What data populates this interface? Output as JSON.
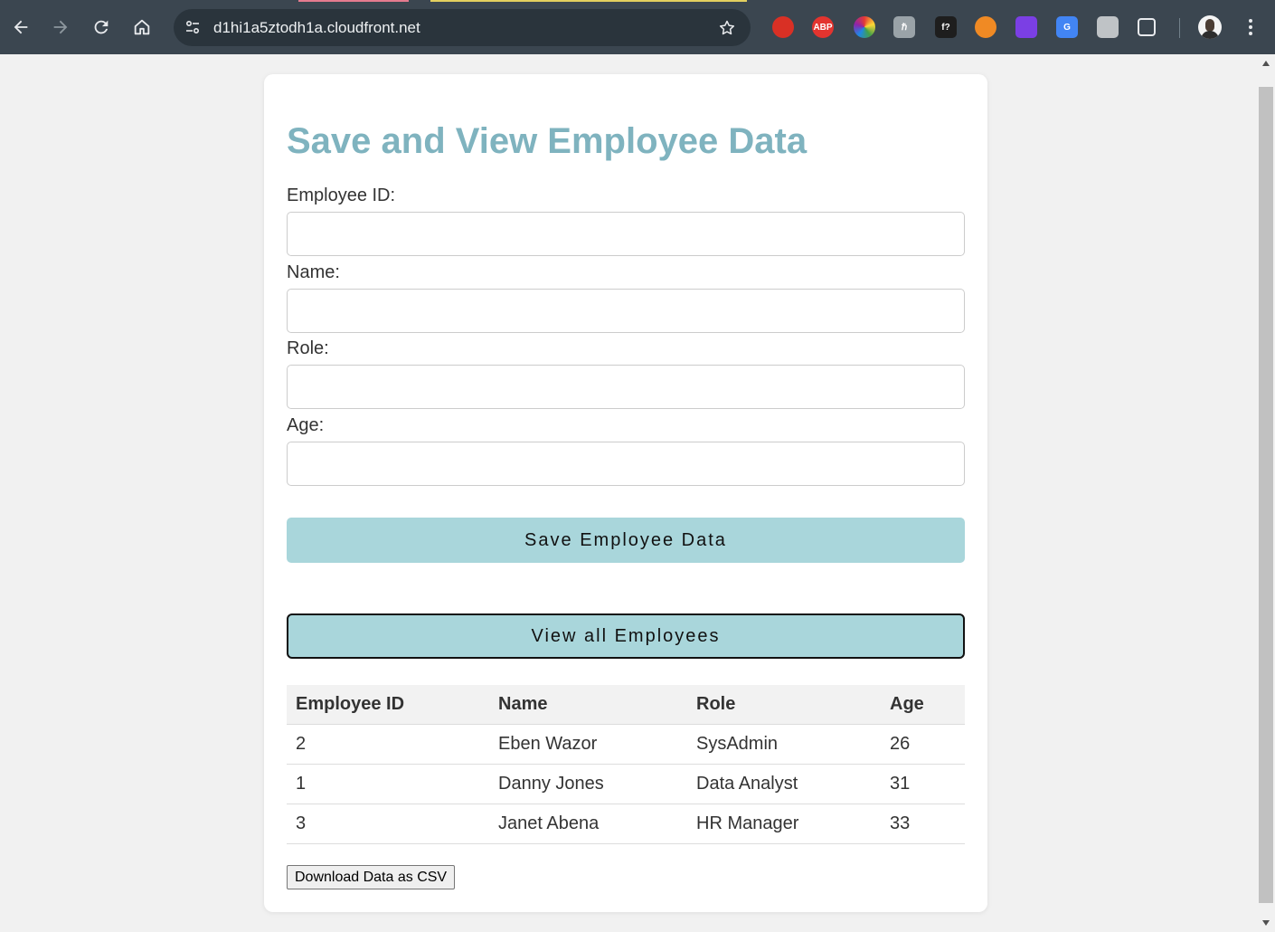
{
  "browser": {
    "url": "d1hi1a5ztodh1a.cloudfront.net",
    "extensions": [
      {
        "name": "stop-hand-extension-icon",
        "text": "",
        "color": "#d93025"
      },
      {
        "name": "adblock-plus-extension-icon",
        "text": "ABP",
        "color": "#e3342f"
      },
      {
        "name": "color-wheel-extension-icon",
        "text": "",
        "color": "#3ea34a"
      },
      {
        "name": "h-extension-icon",
        "text": "ℏ",
        "color": "#9aa3a8"
      },
      {
        "name": "font-finder-extension-icon",
        "text": "f?",
        "color": "#1e1e1e"
      },
      {
        "name": "firefox-relay-extension-icon",
        "text": "",
        "color": "#f08a24"
      },
      {
        "name": "purple-extension-icon",
        "text": "",
        "color": "#7b3fe4"
      },
      {
        "name": "google-translate-extension-icon",
        "text": "G",
        "color": "#4285f4"
      },
      {
        "name": "camera-extension-icon",
        "text": "",
        "color": "#bfc3c6"
      },
      {
        "name": "extensions-puzzle-icon",
        "text": "",
        "color": "#e8eaed"
      }
    ]
  },
  "page": {
    "title": "Save and View Employee Data",
    "form": {
      "employee_id_label": "Employee ID:",
      "employee_id_value": "",
      "name_label": "Name:",
      "name_value": "",
      "role_label": "Role:",
      "role_value": "",
      "age_label": "Age:",
      "age_value": ""
    },
    "save_button": "Save Employee Data",
    "view_button": "View all Employees",
    "table": {
      "headers": [
        "Employee ID",
        "Name",
        "Role",
        "Age"
      ],
      "rows": [
        [
          "2",
          "Eben Wazor",
          "SysAdmin",
          "26"
        ],
        [
          "1",
          "Danny Jones",
          "Data Analyst",
          "31"
        ],
        [
          "3",
          "Janet Abena",
          "HR Manager",
          "33"
        ]
      ]
    },
    "download_button": "Download Data as CSV"
  },
  "colors": {
    "title": "#7fb3bf",
    "button_bg": "#a9d6db",
    "chrome_bg": "#3b4650",
    "page_bg": "#f1f1f1"
  }
}
